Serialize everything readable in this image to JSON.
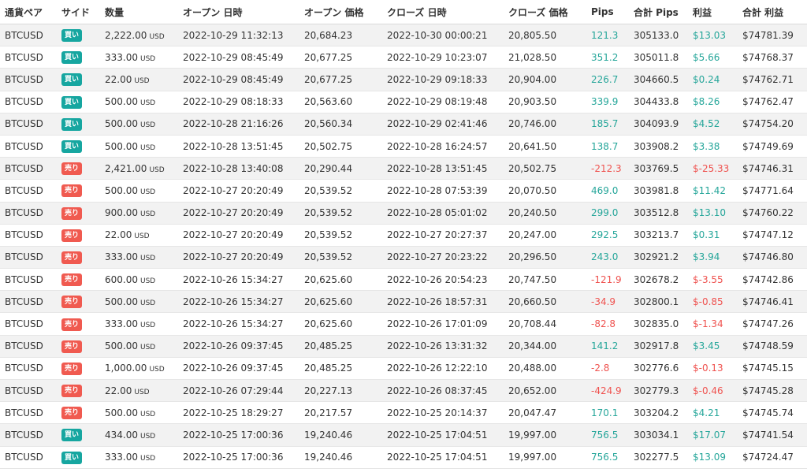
{
  "colors": {
    "buy_badge": "#16a6a0",
    "sell_badge": "#f05a50",
    "positive": "#26a69a",
    "negative": "#ef5350",
    "row_shade": "#f2f2f2"
  },
  "headers": {
    "pair": "通貨ペア",
    "side": "サイド",
    "qty": "数量",
    "open_time": "オープン 日時",
    "open_price": "オープン 価格",
    "close_time": "クローズ 日時",
    "close_price": "クローズ 価格",
    "pips": "Pips",
    "total_pips": "合計 Pips",
    "profit": "利益",
    "total_profit": "合計 利益"
  },
  "rows": [
    {
      "pair": "BTCUSD",
      "side": "買い",
      "side_type": "buy",
      "qty": "2,222.00",
      "unit": "USD",
      "open_time": "2022-10-29 11:32:13",
      "open_price": "20,684.23",
      "close_time": "2022-10-30 00:00:21",
      "close_price": "20,805.50",
      "pips": "121.3",
      "total_pips": "305133.0",
      "profit": "$13.03",
      "total_profit": "$74781.39"
    },
    {
      "pair": "BTCUSD",
      "side": "買い",
      "side_type": "buy",
      "qty": "333.00",
      "unit": "USD",
      "open_time": "2022-10-29 08:45:49",
      "open_price": "20,677.25",
      "close_time": "2022-10-29 10:23:07",
      "close_price": "21,028.50",
      "pips": "351.2",
      "total_pips": "305011.8",
      "profit": "$5.66",
      "total_profit": "$74768.37"
    },
    {
      "pair": "BTCUSD",
      "side": "買い",
      "side_type": "buy",
      "qty": "22.00",
      "unit": "USD",
      "open_time": "2022-10-29 08:45:49",
      "open_price": "20,677.25",
      "close_time": "2022-10-29 09:18:33",
      "close_price": "20,904.00",
      "pips": "226.7",
      "total_pips": "304660.5",
      "profit": "$0.24",
      "total_profit": "$74762.71"
    },
    {
      "pair": "BTCUSD",
      "side": "買い",
      "side_type": "buy",
      "qty": "500.00",
      "unit": "USD",
      "open_time": "2022-10-29 08:18:33",
      "open_price": "20,563.60",
      "close_time": "2022-10-29 08:19:48",
      "close_price": "20,903.50",
      "pips": "339.9",
      "total_pips": "304433.8",
      "profit": "$8.26",
      "total_profit": "$74762.47"
    },
    {
      "pair": "BTCUSD",
      "side": "買い",
      "side_type": "buy",
      "qty": "500.00",
      "unit": "USD",
      "open_time": "2022-10-28 21:16:26",
      "open_price": "20,560.34",
      "close_time": "2022-10-29 02:41:46",
      "close_price": "20,746.00",
      "pips": "185.7",
      "total_pips": "304093.9",
      "profit": "$4.52",
      "total_profit": "$74754.20"
    },
    {
      "pair": "BTCUSD",
      "side": "買い",
      "side_type": "buy",
      "qty": "500.00",
      "unit": "USD",
      "open_time": "2022-10-28 13:51:45",
      "open_price": "20,502.75",
      "close_time": "2022-10-28 16:24:57",
      "close_price": "20,641.50",
      "pips": "138.7",
      "total_pips": "303908.2",
      "profit": "$3.38",
      "total_profit": "$74749.69"
    },
    {
      "pair": "BTCUSD",
      "side": "売り",
      "side_type": "sell",
      "qty": "2,421.00",
      "unit": "USD",
      "open_time": "2022-10-28 13:40:08",
      "open_price": "20,290.44",
      "close_time": "2022-10-28 13:51:45",
      "close_price": "20,502.75",
      "pips": "-212.3",
      "total_pips": "303769.5",
      "profit": "$-25.33",
      "total_profit": "$74746.31"
    },
    {
      "pair": "BTCUSD",
      "side": "売り",
      "side_type": "sell",
      "qty": "500.00",
      "unit": "USD",
      "open_time": "2022-10-27 20:20:49",
      "open_price": "20,539.52",
      "close_time": "2022-10-28 07:53:39",
      "close_price": "20,070.50",
      "pips": "469.0",
      "total_pips": "303981.8",
      "profit": "$11.42",
      "total_profit": "$74771.64"
    },
    {
      "pair": "BTCUSD",
      "side": "売り",
      "side_type": "sell",
      "qty": "900.00",
      "unit": "USD",
      "open_time": "2022-10-27 20:20:49",
      "open_price": "20,539.52",
      "close_time": "2022-10-28 05:01:02",
      "close_price": "20,240.50",
      "pips": "299.0",
      "total_pips": "303512.8",
      "profit": "$13.10",
      "total_profit": "$74760.22"
    },
    {
      "pair": "BTCUSD",
      "side": "売り",
      "side_type": "sell",
      "qty": "22.00",
      "unit": "USD",
      "open_time": "2022-10-27 20:20:49",
      "open_price": "20,539.52",
      "close_time": "2022-10-27 20:27:37",
      "close_price": "20,247.00",
      "pips": "292.5",
      "total_pips": "303213.7",
      "profit": "$0.31",
      "total_profit": "$74747.12"
    },
    {
      "pair": "BTCUSD",
      "side": "売り",
      "side_type": "sell",
      "qty": "333.00",
      "unit": "USD",
      "open_time": "2022-10-27 20:20:49",
      "open_price": "20,539.52",
      "close_time": "2022-10-27 20:23:22",
      "close_price": "20,296.50",
      "pips": "243.0",
      "total_pips": "302921.2",
      "profit": "$3.94",
      "total_profit": "$74746.80"
    },
    {
      "pair": "BTCUSD",
      "side": "売り",
      "side_type": "sell",
      "qty": "600.00",
      "unit": "USD",
      "open_time": "2022-10-26 15:34:27",
      "open_price": "20,625.60",
      "close_time": "2022-10-26 20:54:23",
      "close_price": "20,747.50",
      "pips": "-121.9",
      "total_pips": "302678.2",
      "profit": "$-3.55",
      "total_profit": "$74742.86"
    },
    {
      "pair": "BTCUSD",
      "side": "売り",
      "side_type": "sell",
      "qty": "500.00",
      "unit": "USD",
      "open_time": "2022-10-26 15:34:27",
      "open_price": "20,625.60",
      "close_time": "2022-10-26 18:57:31",
      "close_price": "20,660.50",
      "pips": "-34.9",
      "total_pips": "302800.1",
      "profit": "$-0.85",
      "total_profit": "$74746.41"
    },
    {
      "pair": "BTCUSD",
      "side": "売り",
      "side_type": "sell",
      "qty": "333.00",
      "unit": "USD",
      "open_time": "2022-10-26 15:34:27",
      "open_price": "20,625.60",
      "close_time": "2022-10-26 17:01:09",
      "close_price": "20,708.44",
      "pips": "-82.8",
      "total_pips": "302835.0",
      "profit": "$-1.34",
      "total_profit": "$74747.26"
    },
    {
      "pair": "BTCUSD",
      "side": "売り",
      "side_type": "sell",
      "qty": "500.00",
      "unit": "USD",
      "open_time": "2022-10-26 09:37:45",
      "open_price": "20,485.25",
      "close_time": "2022-10-26 13:31:32",
      "close_price": "20,344.00",
      "pips": "141.2",
      "total_pips": "302917.8",
      "profit": "$3.45",
      "total_profit": "$74748.59"
    },
    {
      "pair": "BTCUSD",
      "side": "売り",
      "side_type": "sell",
      "qty": "1,000.00",
      "unit": "USD",
      "open_time": "2022-10-26 09:37:45",
      "open_price": "20,485.25",
      "close_time": "2022-10-26 12:22:10",
      "close_price": "20,488.00",
      "pips": "-2.8",
      "total_pips": "302776.6",
      "profit": "$-0.13",
      "total_profit": "$74745.15"
    },
    {
      "pair": "BTCUSD",
      "side": "売り",
      "side_type": "sell",
      "qty": "22.00",
      "unit": "USD",
      "open_time": "2022-10-26 07:29:44",
      "open_price": "20,227.13",
      "close_time": "2022-10-26 08:37:45",
      "close_price": "20,652.00",
      "pips": "-424.9",
      "total_pips": "302779.3",
      "profit": "$-0.46",
      "total_profit": "$74745.28"
    },
    {
      "pair": "BTCUSD",
      "side": "売り",
      "side_type": "sell",
      "qty": "500.00",
      "unit": "USD",
      "open_time": "2022-10-25 18:29:27",
      "open_price": "20,217.57",
      "close_time": "2022-10-25 20:14:37",
      "close_price": "20,047.47",
      "pips": "170.1",
      "total_pips": "303204.2",
      "profit": "$4.21",
      "total_profit": "$74745.74"
    },
    {
      "pair": "BTCUSD",
      "side": "買い",
      "side_type": "buy",
      "qty": "434.00",
      "unit": "USD",
      "open_time": "2022-10-25 17:00:36",
      "open_price": "19,240.46",
      "close_time": "2022-10-25 17:04:51",
      "close_price": "19,997.00",
      "pips": "756.5",
      "total_pips": "303034.1",
      "profit": "$17.07",
      "total_profit": "$74741.54"
    },
    {
      "pair": "BTCUSD",
      "side": "買い",
      "side_type": "buy",
      "qty": "333.00",
      "unit": "USD",
      "open_time": "2022-10-25 17:00:36",
      "open_price": "19,240.46",
      "close_time": "2022-10-25 17:04:51",
      "close_price": "19,997.00",
      "pips": "756.5",
      "total_pips": "302277.5",
      "profit": "$13.09",
      "total_profit": "$74724.47"
    }
  ]
}
